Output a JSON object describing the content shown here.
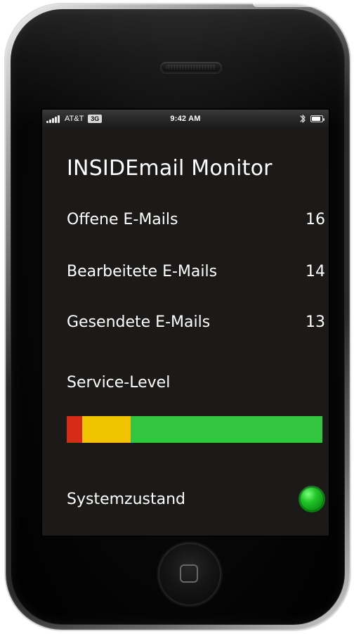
{
  "status_bar": {
    "carrier": "AT&T",
    "network": "3G",
    "time": "9:42 AM",
    "battery_level": 0.85
  },
  "app": {
    "title": "INSIDEmail  Monitor",
    "metrics": [
      {
        "label": "Offene E-Mails",
        "value": "16"
      },
      {
        "label": "Bearbeitete E-Mails",
        "value": "14"
      },
      {
        "label": "Gesendete E-Mails",
        "value": "13"
      }
    ],
    "service_level": {
      "label": "Service-Level",
      "segments": [
        {
          "name": "red",
          "color": "#d62b16",
          "fraction": 0.06
        },
        {
          "name": "yellow",
          "color": "#f0c400",
          "fraction": 0.19
        },
        {
          "name": "green",
          "color": "#35c43d",
          "fraction": 0.75
        }
      ]
    },
    "system_state": {
      "label": "Systemzustand",
      "indicator_color": "#22c52a"
    }
  },
  "icons": {
    "signal": "signal-strength-icon",
    "bluetooth": "bluetooth-icon",
    "battery": "battery-icon",
    "home": "home-button-icon"
  },
  "colors": {
    "screen_bg": "#1c1a18",
    "text": "#ffffff"
  }
}
